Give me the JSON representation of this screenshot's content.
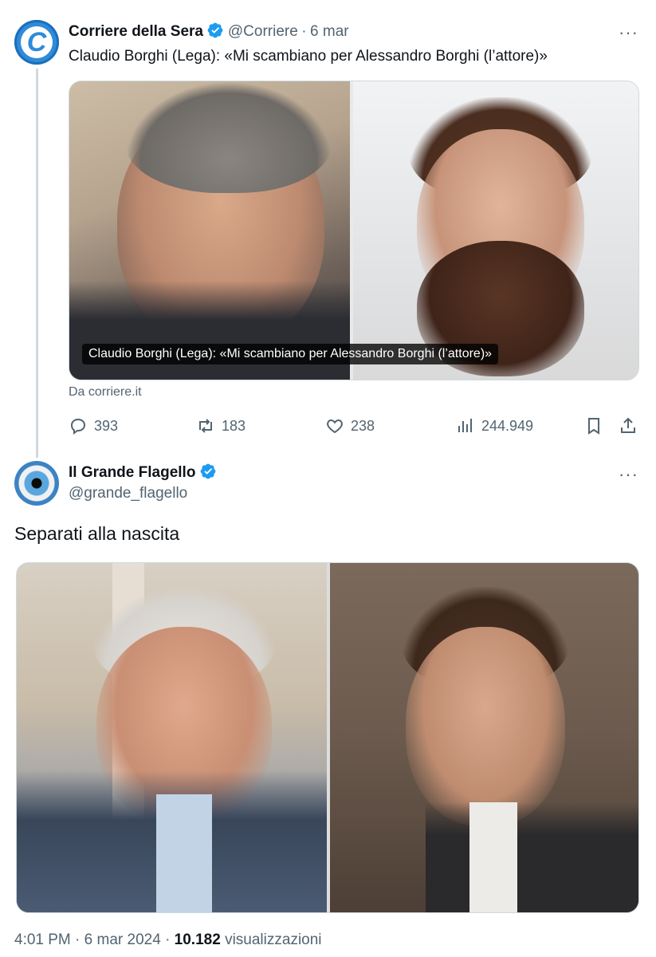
{
  "quoted_tweet": {
    "name": "Corriere della Sera",
    "handle": "@Corriere",
    "separator": "·",
    "date": "6 mar",
    "text": "Claudio Borghi (Lega): «Mi scambiano per Alessandro Borghi (l’attore)»",
    "card_caption": "Claudio Borghi (Lega): «Mi scambiano per Alessandro Borghi (l’attore)»",
    "source": "Da corriere.it",
    "more": "···",
    "actions": {
      "replies": "393",
      "retweets": "183",
      "likes": "238",
      "views": "244.949"
    },
    "icons": [
      "more-icon",
      "verified-icon",
      "reply-icon",
      "retweet-icon",
      "like-icon",
      "views-icon",
      "bookmark-icon",
      "share-icon"
    ]
  },
  "main_tweet": {
    "name": "Il Grande Flagello",
    "handle": "@grande_flagello",
    "text": "Separati alla nascita",
    "more": "···",
    "time": "4:01 PM",
    "separator": "·",
    "date": "6 mar 2024",
    "separator2": "·",
    "views_count": "10.182",
    "views_label": "visualizzazioni"
  },
  "colors": {
    "verified": "#1d9bf0",
    "secondary_text": "#536471",
    "border": "#cfd9de"
  }
}
